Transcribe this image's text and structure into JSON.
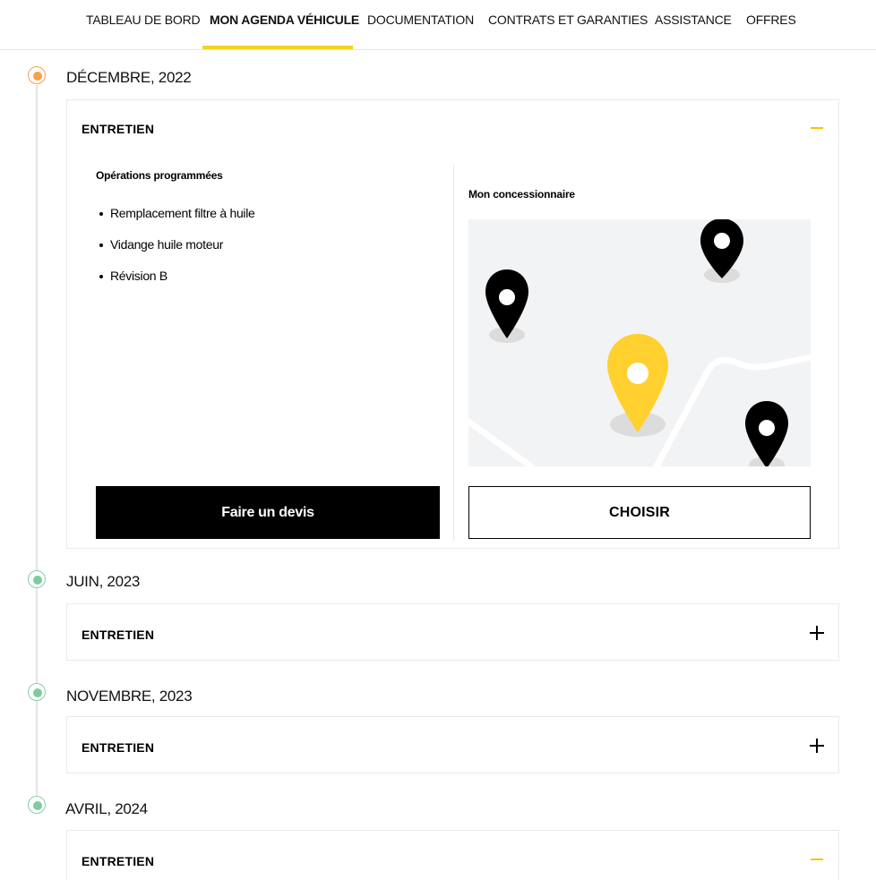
{
  "nav": {
    "items": [
      {
        "label": "TABLEAU DE BORD"
      },
      {
        "label": "MON AGENDA VÉHICULE"
      },
      {
        "label": "DOCUMENTATION"
      },
      {
        "label": "CONTRATS ET GARANTIES"
      },
      {
        "label": "ASSISTANCE"
      },
      {
        "label": "OFFRES"
      }
    ],
    "active_index": 1,
    "accent_color": "#f5d21f"
  },
  "timeline": [
    {
      "month": "DÉCEMBRE, 2022",
      "status_color": "#f7a04a",
      "card": {
        "title": "ENTRETIEN",
        "expanded": true,
        "operations_title": "Opérations programmées",
        "operations": [
          "Remplacement filtre à huile",
          "Vidange huile moteur",
          "Révision B"
        ],
        "dealer_title": "Mon concessionnaire",
        "quote_button": "Faire un devis",
        "choose_button": "CHOISIR"
      }
    },
    {
      "month": "JUIN, 2023",
      "status_color": "#7fcb9d",
      "card": {
        "title": "ENTRETIEN",
        "expanded": false
      }
    },
    {
      "month": "NOVEMBRE, 2023",
      "status_color": "#7fcb9d",
      "card": {
        "title": "ENTRETIEN",
        "expanded": false
      }
    },
    {
      "month": "AVRIL, 2024",
      "status_color": "#7fcb9d",
      "card": {
        "title": "ENTRETIEN",
        "expanded": true
      }
    }
  ],
  "map": {
    "background": "#f2f3f5",
    "pin_colors": {
      "dealer": "#ffd02e",
      "other": "#000000"
    }
  }
}
